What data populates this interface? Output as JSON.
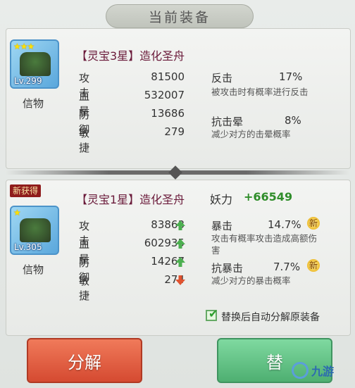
{
  "header": {
    "title": "当前装备"
  },
  "current": {
    "stars": "★★★",
    "level": "Lv.299",
    "item_label": "信物",
    "name": "【灵宝3星】造化圣舟",
    "stats": [
      {
        "label": "攻击",
        "value": "81500"
      },
      {
        "label": "血量",
        "value": "532007"
      },
      {
        "label": "防御",
        "value": "13686"
      },
      {
        "label": "敏捷",
        "value": "279"
      }
    ],
    "skills": [
      {
        "name": "反击",
        "pct": "17%",
        "desc": "被攻击时有概率进行反击"
      },
      {
        "name": "抗击晕",
        "pct": "8%",
        "desc": "减少对方的击晕概率"
      }
    ]
  },
  "new_item": {
    "badge": "新获得",
    "stars": "★",
    "level": "Lv.305",
    "item_label": "信物",
    "name": "【灵宝1星】造化圣舟",
    "power_label": "妖力",
    "power_value": "+66549",
    "stats": [
      {
        "label": "攻击",
        "value": "83863",
        "trend": "up"
      },
      {
        "label": "血量",
        "value": "602935",
        "trend": "up"
      },
      {
        "label": "防御",
        "value": "14267",
        "trend": "up"
      },
      {
        "label": "敏捷",
        "value": "274",
        "trend": "down"
      }
    ],
    "skills": [
      {
        "name": "暴击",
        "pct": "14.7%",
        "new": "新",
        "desc": "攻击有概率攻击造成高额伤害"
      },
      {
        "name": "抗暴击",
        "pct": "7.7%",
        "new": "新",
        "desc": "减少对方的暴击概率"
      }
    ]
  },
  "options": {
    "auto_decompose_label": "替换后自动分解原装备",
    "auto_decompose_checked": true
  },
  "buttons": {
    "decompose": "分解",
    "replace": "替"
  },
  "watermark": {
    "logo_text": "九游"
  },
  "colors": {
    "up": "#4caf50",
    "down": "#e0532f",
    "power": "#2f8d2a"
  }
}
